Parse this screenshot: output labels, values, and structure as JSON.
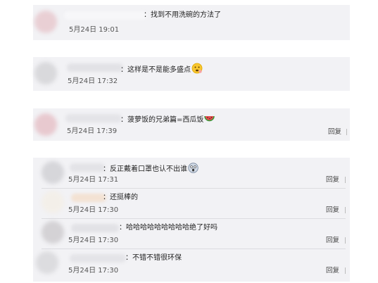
{
  "comments": [
    {
      "text": "：找到不用洗碗的方法了",
      "date": "5月24日 19:01"
    },
    {
      "text": "：这样是不是能多盛点",
      "emoji": "thinking-face-icon",
      "date": "5月24日 17:32"
    },
    {
      "text": "：菠萝饭的兄弟篇=西瓜饭",
      "emoji": "watermelon-icon",
      "date": "5月24日 17:39",
      "reply": "回复"
    }
  ],
  "thread": [
    {
      "text": "：反正戴着口罩也认不出谁",
      "emoji": "scared-face-icon",
      "date": "5月24日 17:31",
      "reply": "回复"
    },
    {
      "text": "：还挺棒的",
      "date": "5月24日 17:30",
      "reply": "回复"
    },
    {
      "text": "：哈哈哈哈哈哈哈哈哈绝了好吗",
      "date": "5月24日 17:30",
      "reply": "回复"
    },
    {
      "text": "：不错不错很环保",
      "date": "5月24日 17:30",
      "reply": "回复"
    }
  ]
}
